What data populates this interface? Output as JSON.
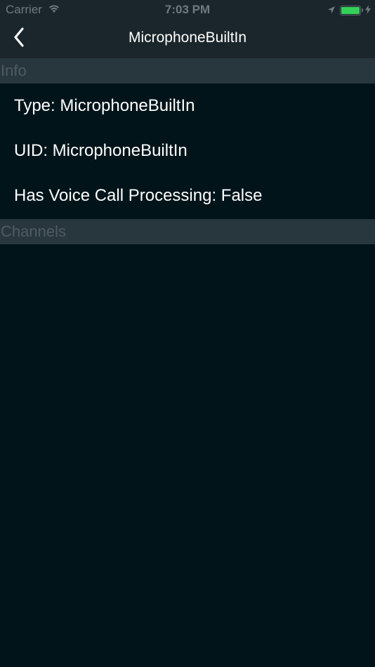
{
  "status_bar": {
    "carrier": "Carrier",
    "time": "7:03 PM",
    "battery_level": 1.0,
    "battery_color": "#33d158",
    "icons": [
      "wifi-icon",
      "location-arrow-icon",
      "battery-icon",
      "charging-bolt-icon"
    ]
  },
  "nav": {
    "title": "MicrophoneBuiltIn",
    "back_icon": "chevron-left-icon"
  },
  "sections": {
    "info": {
      "header": "Info",
      "rows": [
        "Type: MicrophoneBuiltIn",
        "UID: MicrophoneBuiltIn",
        "Has Voice Call Processing: False"
      ]
    },
    "channels": {
      "header": "Channels"
    }
  },
  "colors": {
    "background": "#01141a",
    "bar": "#1b262c",
    "section_header": "#28373e"
  }
}
